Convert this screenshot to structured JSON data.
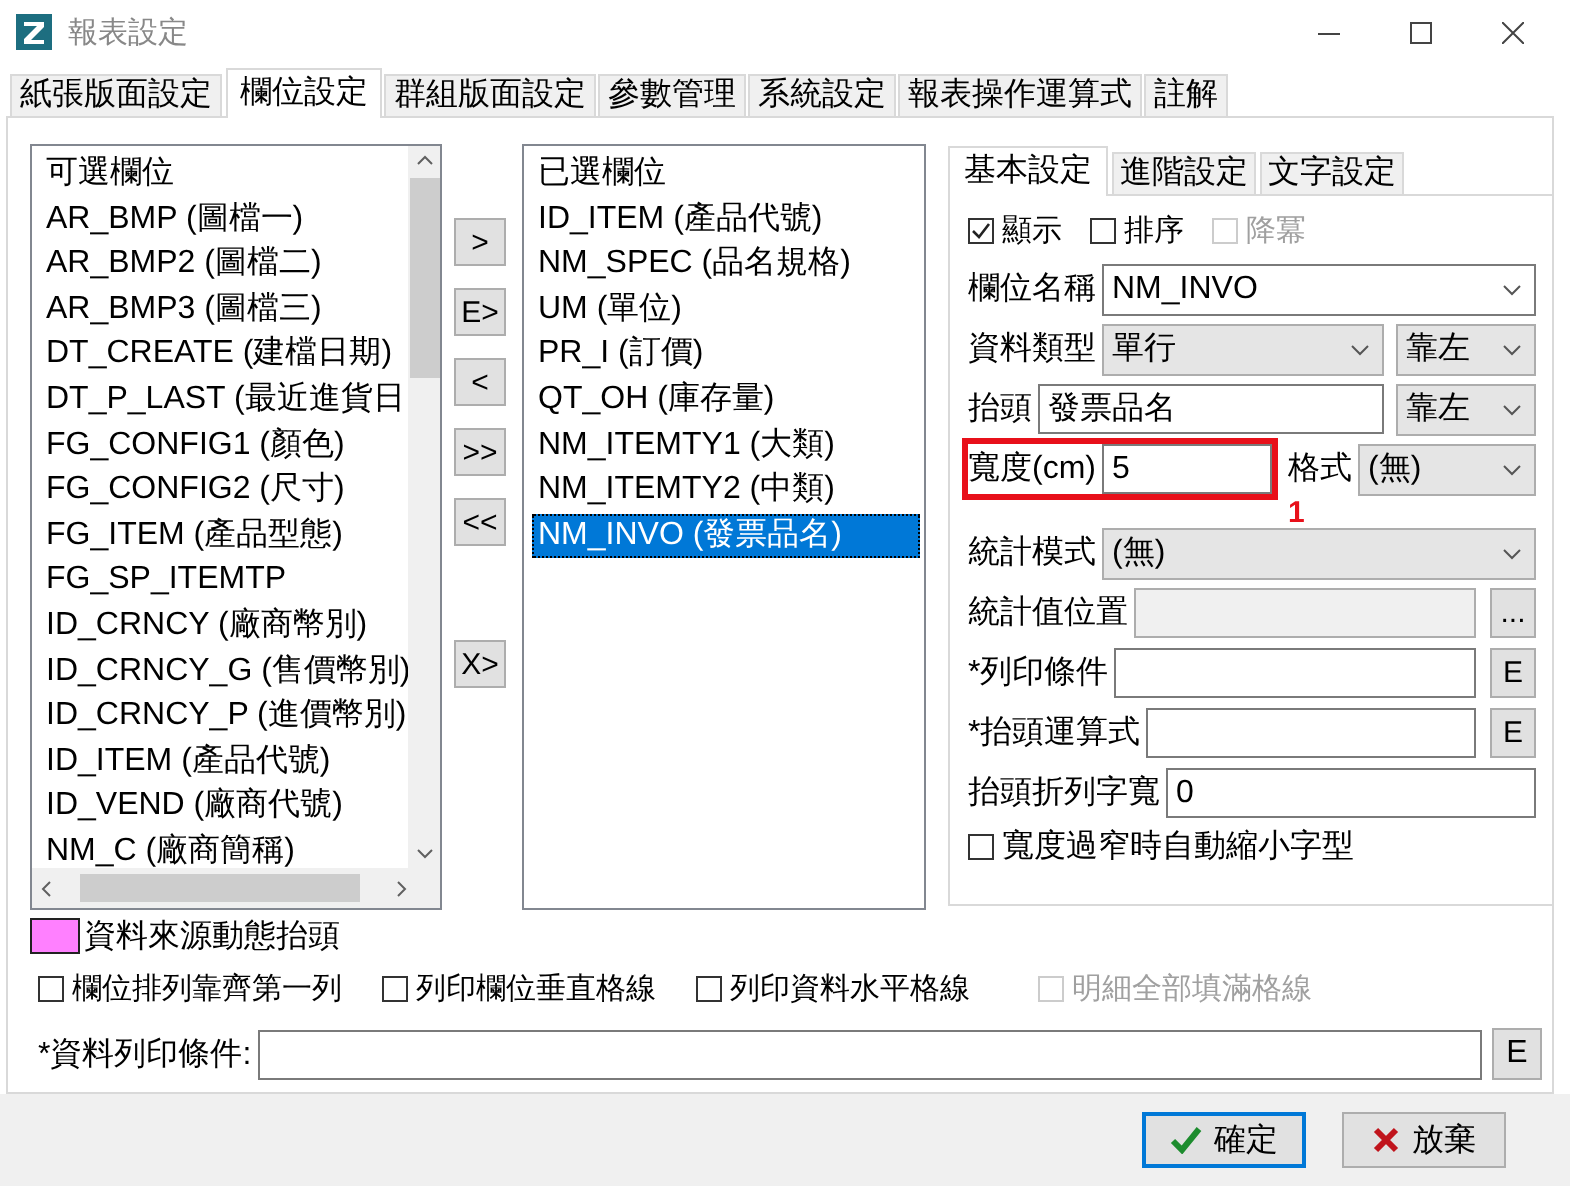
{
  "window": {
    "title": "報表設定"
  },
  "tabs": [
    {
      "label": "紙張版面設定",
      "selected": false
    },
    {
      "label": "欄位設定",
      "selected": true
    },
    {
      "label": "群組版面設定",
      "selected": false
    },
    {
      "label": "參數管理",
      "selected": false
    },
    {
      "label": "系統設定",
      "selected": false
    },
    {
      "label": "報表操作運算式",
      "selected": false
    },
    {
      "label": "註解",
      "selected": false
    }
  ],
  "available_fields": {
    "header": "可選欄位",
    "items": [
      {
        "label": "AR_BMP (圖檔一)",
        "selected": false
      },
      {
        "label": "AR_BMP2 (圖檔二)",
        "selected": false
      },
      {
        "label": "AR_BMP3 (圖檔三)",
        "selected": false
      },
      {
        "label": "DT_CREATE (建檔日期)",
        "selected": false
      },
      {
        "label": "DT_P_LAST (最近進貨日",
        "selected": false
      },
      {
        "label": "FG_CONFIG1 (顏色)",
        "selected": false
      },
      {
        "label": "FG_CONFIG2 (尺寸)",
        "selected": false
      },
      {
        "label": "FG_ITEM (產品型態)",
        "selected": false
      },
      {
        "label": "FG_SP_ITEMTP",
        "selected": false
      },
      {
        "label": "ID_CRNCY (廠商幣別)",
        "selected": false
      },
      {
        "label": "ID_CRNCY_G (售價幣別)",
        "selected": false
      },
      {
        "label": "ID_CRNCY_P (進價幣別)",
        "selected": false
      },
      {
        "label": "ID_ITEM (產品代號)",
        "selected": false
      },
      {
        "label": "ID_VEND (廠商代號)",
        "selected": false
      },
      {
        "label": "NM_C (廠商簡稱)",
        "selected": false
      }
    ]
  },
  "move_buttons": [
    ">",
    "E>",
    "<",
    ">>",
    "<<",
    "X>"
  ],
  "selected_fields": {
    "header": "已選欄位",
    "items": [
      {
        "label": "ID_ITEM (產品代號)",
        "selected": false
      },
      {
        "label": "NM_SPEC (品名規格)",
        "selected": false
      },
      {
        "label": "UM (單位)",
        "selected": false
      },
      {
        "label": "PR_I (訂價)",
        "selected": false
      },
      {
        "label": "QT_OH (庫存量)",
        "selected": false
      },
      {
        "label": "NM_ITEMTY1 (大類)",
        "selected": false
      },
      {
        "label": "NM_ITEMTY2 (中類)",
        "selected": false
      },
      {
        "label": "NM_INVO (發票品名)",
        "selected": true
      }
    ]
  },
  "settings_tabs": [
    {
      "label": "基本設定",
      "selected": true
    },
    {
      "label": "進階設定",
      "selected": false
    },
    {
      "label": "文字設定",
      "selected": false
    }
  ],
  "settings": {
    "checkboxes": [
      {
        "label": "顯示",
        "checked": true,
        "disabled": false
      },
      {
        "label": "排序",
        "checked": false,
        "disabled": false
      },
      {
        "label": "降冪",
        "checked": false,
        "disabled": true
      }
    ],
    "rows": [
      {
        "label": "欄位名稱",
        "controls": [
          {
            "kind": "combo",
            "value": "NM_INVO",
            "editable": true
          }
        ]
      },
      {
        "label": "資料類型",
        "controls": [
          {
            "kind": "combo",
            "value": "單行",
            "editable": false
          },
          {
            "kind": "combo",
            "value": "靠左",
            "editable": false
          }
        ]
      },
      {
        "label": "抬頭",
        "controls": [
          {
            "kind": "text",
            "value": "發票品名",
            "disabled": false
          },
          {
            "kind": "combo",
            "value": "靠左",
            "editable": false
          }
        ]
      },
      {
        "label": "寬度(cm)",
        "annotation": "1",
        "controls": [
          {
            "kind": "text",
            "value": "5",
            "disabled": false
          },
          {
            "kind": "label",
            "text": "格式"
          },
          {
            "kind": "combo",
            "value": "(無)",
            "editable": false
          }
        ]
      },
      {
        "label": "統計模式",
        "controls": [
          {
            "kind": "combo",
            "value": "(無)",
            "editable": false
          }
        ]
      },
      {
        "label": "統計值位置",
        "controls": [
          {
            "kind": "text",
            "disabled": true
          },
          {
            "kind": "button",
            "text": "..."
          }
        ]
      },
      {
        "label": "*列印條件",
        "controls": [
          {
            "kind": "text",
            "disabled": false
          },
          {
            "kind": "button",
            "text": "E"
          }
        ]
      },
      {
        "label": "*抬頭運算式",
        "controls": [
          {
            "kind": "text",
            "disabled": false
          },
          {
            "kind": "button",
            "text": "E"
          }
        ]
      },
      {
        "label": "抬頭折列字寬",
        "controls": [
          {
            "kind": "text",
            "value": "0",
            "disabled": false
          }
        ]
      }
    ],
    "shrink_checkbox": {
      "label": "寬度過窄時自動縮小字型",
      "checked": false,
      "disabled": false
    }
  },
  "legend": {
    "color": "#ff80ff",
    "label": "資料來源動態抬頭"
  },
  "options": [
    {
      "label": "欄位排列靠齊第一列",
      "checked": false,
      "disabled": false
    },
    {
      "label": "列印欄位垂直格線",
      "checked": false,
      "disabled": false
    },
    {
      "label": "列印資料水平格線",
      "checked": false,
      "disabled": false
    },
    {
      "label": "明細全部填滿格線",
      "checked": false,
      "disabled": true
    }
  ],
  "condition": {
    "label": "*資料列印條件:",
    "button": "E"
  },
  "footer_buttons": [
    {
      "kind": "confirm",
      "label": "確定",
      "focused": true
    },
    {
      "kind": "cancel",
      "label": "放棄",
      "focused": false
    }
  ]
}
